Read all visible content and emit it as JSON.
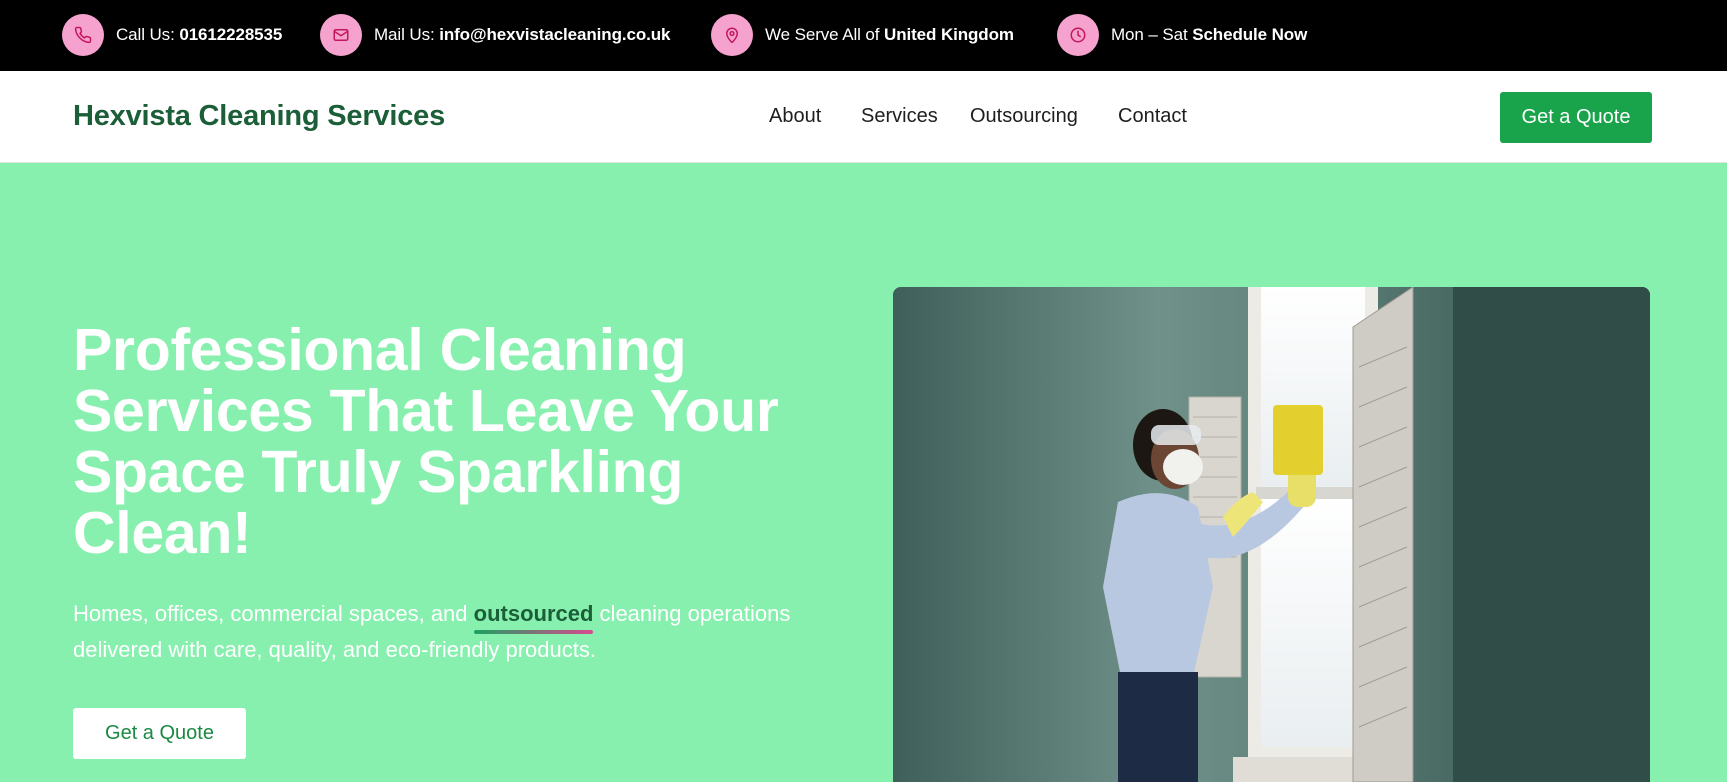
{
  "topbar": {
    "phone": {
      "icon": "phone-icon",
      "label": "Call Us:",
      "value": "01612228535"
    },
    "mail": {
      "icon": "mail-icon",
      "label": "Mail Us:",
      "value": "info@hexvistacleaning.co.uk"
    },
    "location": {
      "icon": "location-pin-icon",
      "label": "We Serve All of",
      "value": "United Kingdom"
    },
    "hours": {
      "icon": "clock-icon",
      "label": "Mon – Sat",
      "value": "Schedule Now"
    }
  },
  "nav": {
    "logo": "Hexvista Cleaning Services",
    "links": [
      "About",
      "Services",
      "Outsourcing",
      "Contact"
    ],
    "cta": "Get a Quote"
  },
  "hero": {
    "title": "Professional Cleaning Services That Leave Your Space Truly Sparkling Clean!",
    "subtitle_before": "Homes, offices, commercial spaces, and ",
    "subtitle_highlight": "outsourced",
    "subtitle_after": " cleaning operations delivered with care, quality, and eco-friendly products.",
    "cta": "Get a Quote"
  },
  "colors": {
    "topbar_bg": "#000000",
    "icon_circle": "#f6a2cf",
    "brand_green": "#1b5e38",
    "button_green": "#19a34a",
    "hero_bg": "#87f0ae"
  }
}
